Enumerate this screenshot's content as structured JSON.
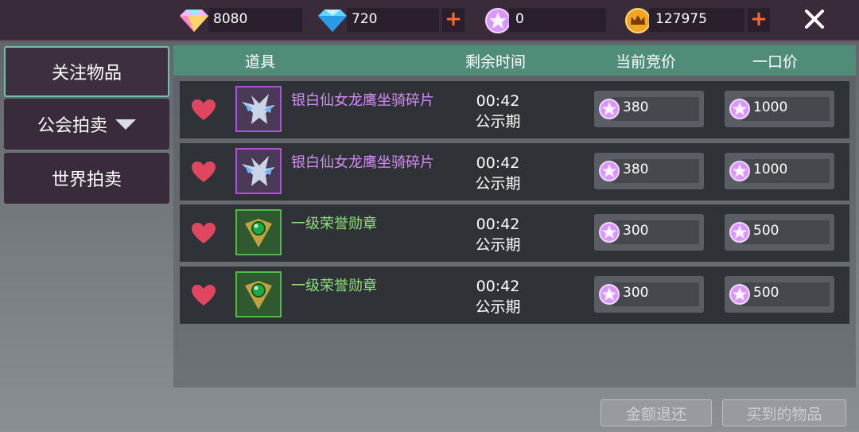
{
  "currencies": [
    {
      "name": "rainbow-diamond-icon",
      "value": "8080",
      "plus": false
    },
    {
      "name": "blue-diamond-icon",
      "value": "720",
      "plus": true
    },
    {
      "name": "star-coin-icon",
      "value": "0",
      "plus": false
    },
    {
      "name": "gold-crown-icon",
      "value": "127975",
      "plus": true
    }
  ],
  "tabs": {
    "favorites": "关注物品",
    "guild": "公会拍卖",
    "world": "世界拍卖"
  },
  "table": {
    "headers": {
      "item": "道具",
      "time": "剩余时间",
      "bid": "当前竞价",
      "buyout": "一口价"
    },
    "rows": [
      {
        "name": "银白仙女龙鹰坐骑碎片",
        "rarity": "purple",
        "time": "00:42",
        "phase": "公示期",
        "bid": "380",
        "buyout": "1000"
      },
      {
        "name": "银白仙女龙鹰坐骑碎片",
        "rarity": "purple",
        "time": "00:42",
        "phase": "公示期",
        "bid": "380",
        "buyout": "1000"
      },
      {
        "name": "一级荣誉勋章",
        "rarity": "green",
        "time": "00:42",
        "phase": "公示期",
        "bid": "300",
        "buyout": "500"
      },
      {
        "name": "一级荣誉勋章",
        "rarity": "green",
        "time": "00:42",
        "phase": "公示期",
        "bid": "300",
        "buyout": "500"
      }
    ]
  },
  "buttons": {
    "refund": "金额退还",
    "purchased": "买到的物品"
  },
  "colors": {
    "header_green": "#4f8d78",
    "rarity_purple": "#d58cf5",
    "rarity_green": "#8ee27a",
    "heart": "#e0465f",
    "plus": "#ff6a2a"
  }
}
